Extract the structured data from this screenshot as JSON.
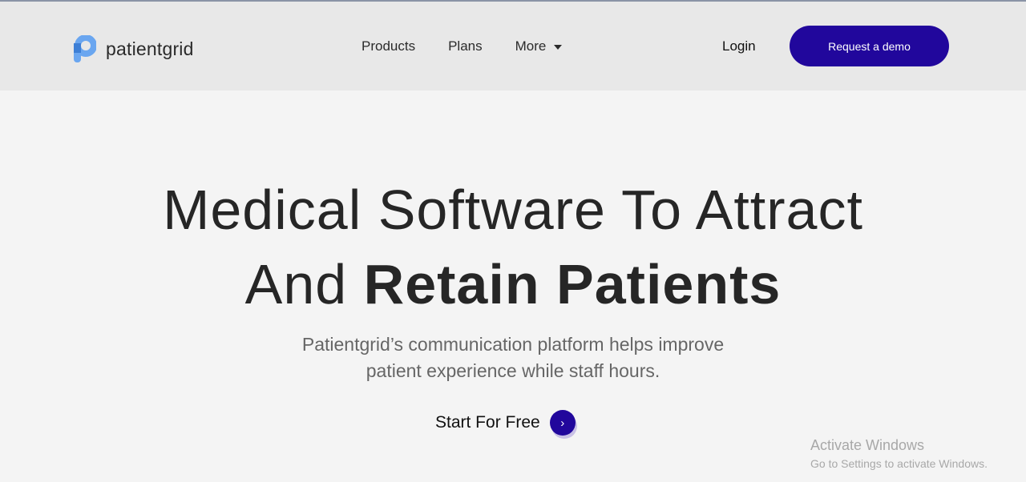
{
  "header": {
    "brand": "patientgrid",
    "nav": [
      {
        "label": "Products"
      },
      {
        "label": "Plans"
      },
      {
        "label": "More"
      }
    ],
    "login_label": "Login",
    "demo_label": "Request a demo",
    "accent_color": "#21079c"
  },
  "hero": {
    "title_line1": "Medical Software To Attract",
    "title_line2_regular": "And ",
    "title_line2_bold": "Retain Patients",
    "subtitle_line1": "Patientgrid’s communication platform helps improve",
    "subtitle_line2": "patient experience while staff hours.",
    "cta_label": "Start For Free",
    "cta_icon": "chevron-right-icon"
  },
  "watermark": {
    "line1": "Activate Windows",
    "line2": "Go to Settings to activate Windows."
  }
}
